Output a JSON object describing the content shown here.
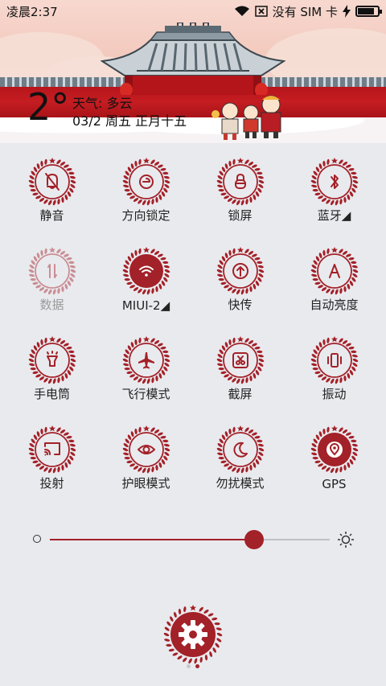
{
  "status_bar": {
    "time": "凌晨2:37",
    "no_sim": "没有 SIM 卡",
    "battery_level": 0.85
  },
  "weather": {
    "temperature": "2°",
    "condition": "天气: 多云",
    "date": "03/2  周五  正月十五"
  },
  "theme": {
    "accent": "#a32128",
    "wall_red": "#c41d22"
  },
  "toggles": [
    {
      "label": "静音",
      "icon": "bell-off-icon",
      "state": "off"
    },
    {
      "label": "方向锁定",
      "icon": "rotation-lock-icon",
      "state": "off"
    },
    {
      "label": "锁屏",
      "icon": "lock-icon",
      "state": "off"
    },
    {
      "label": "蓝牙◢",
      "icon": "bluetooth-icon",
      "state": "off"
    },
    {
      "label": "数据",
      "icon": "mobile-data-icon",
      "state": "disabled"
    },
    {
      "label": "MIUI-2◢",
      "icon": "wifi-icon",
      "state": "on"
    },
    {
      "label": "快传",
      "icon": "quick-send-icon",
      "state": "off"
    },
    {
      "label": "自动亮度",
      "icon": "auto-brightness-icon",
      "state": "off"
    },
    {
      "label": "手电筒",
      "icon": "flashlight-icon",
      "state": "off"
    },
    {
      "label": "飞行模式",
      "icon": "airplane-icon",
      "state": "off"
    },
    {
      "label": "截屏",
      "icon": "screenshot-icon",
      "state": "off"
    },
    {
      "label": "振动",
      "icon": "vibrate-icon",
      "state": "off"
    },
    {
      "label": "投射",
      "icon": "cast-icon",
      "state": "off"
    },
    {
      "label": "护眼模式",
      "icon": "eye-icon",
      "state": "off"
    },
    {
      "label": "勿扰模式",
      "icon": "moon-icon",
      "state": "off"
    },
    {
      "label": "GPS",
      "icon": "gps-icon",
      "state": "on"
    }
  ],
  "brightness": {
    "level": 0.73
  },
  "pager": {
    "pages": 2,
    "current": 2
  }
}
